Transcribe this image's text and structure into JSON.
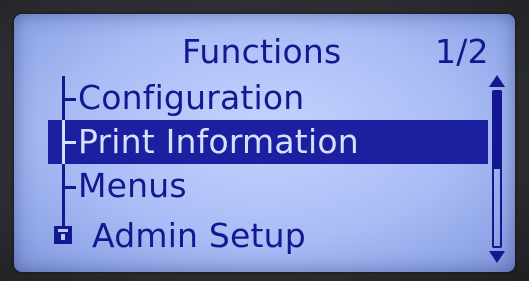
{
  "screen": {
    "title": "Functions",
    "page_indicator": "1/2"
  },
  "menu": {
    "items": [
      {
        "label": "Configuration",
        "selected": false,
        "icon": "tree-branch"
      },
      {
        "label": "Print Information",
        "selected": true,
        "icon": "tree-branch"
      },
      {
        "label": "Menus",
        "selected": false,
        "icon": "tree-branch"
      },
      {
        "label": "Admin Setup",
        "selected": false,
        "icon": "lock-icon"
      }
    ]
  },
  "scrollbar": {
    "position_fraction": 0.0,
    "visible_fraction": 0.5
  },
  "colors": {
    "lcd_background": "#b8c8fa",
    "lcd_text": "#14178f",
    "selection_background": "#1c20a0",
    "selection_text": "#d8e0ff"
  }
}
